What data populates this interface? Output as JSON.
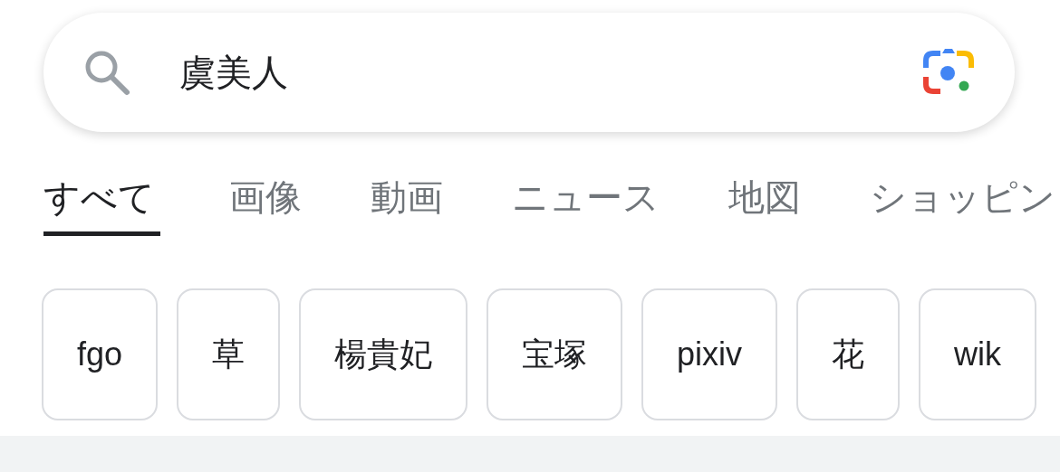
{
  "search": {
    "value": "虞美人"
  },
  "tabs": [
    {
      "label": "すべて",
      "selected": true
    },
    {
      "label": "画像",
      "selected": false
    },
    {
      "label": "動画",
      "selected": false
    },
    {
      "label": "ニュース",
      "selected": false
    },
    {
      "label": "地図",
      "selected": false
    },
    {
      "label": "ショッピン",
      "selected": false
    }
  ],
  "chips": [
    {
      "label": "fgo"
    },
    {
      "label": "草"
    },
    {
      "label": "楊貴妃"
    },
    {
      "label": "宝塚"
    },
    {
      "label": "pixiv"
    },
    {
      "label": "花"
    },
    {
      "label": "wik"
    }
  ]
}
